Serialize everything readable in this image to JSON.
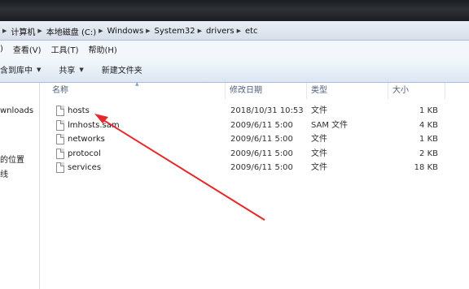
{
  "address": {
    "crumbs": [
      "计算机",
      "本地磁盘 (C:)",
      "Windows",
      "System32",
      "drivers",
      "etc"
    ]
  },
  "menu": {
    "view": "查看(V)",
    "tools": "工具(T)",
    "help": "帮助(H)"
  },
  "toolbar": {
    "include_in_library": "含到库中",
    "share": "共享",
    "new_folder": "新建文件夹"
  },
  "nav": {
    "downloads": "wnloads",
    "recent_places": "的位置",
    "partial": "线"
  },
  "columns": {
    "name": "名称",
    "modified": "修改日期",
    "type": "类型",
    "size": "大小"
  },
  "files": [
    {
      "name": "hosts",
      "modified": "2018/10/31 10:53",
      "type": "文件",
      "size": "1 KB"
    },
    {
      "name": "lmhosts.sam",
      "modified": "2009/6/11 5:00",
      "type": "SAM 文件",
      "size": "4 KB"
    },
    {
      "name": "networks",
      "modified": "2009/6/11 5:00",
      "type": "文件",
      "size": "1 KB"
    },
    {
      "name": "protocol",
      "modified": "2009/6/11 5:00",
      "type": "文件",
      "size": "2 KB"
    },
    {
      "name": "services",
      "modified": "2009/6/11 5:00",
      "type": "文件",
      "size": "18 KB"
    }
  ],
  "annotation": {
    "arrow_color": "#e8262a"
  },
  "colors": {
    "header_text": "#4c607a",
    "toolbar_bg": "#dce7f3"
  }
}
